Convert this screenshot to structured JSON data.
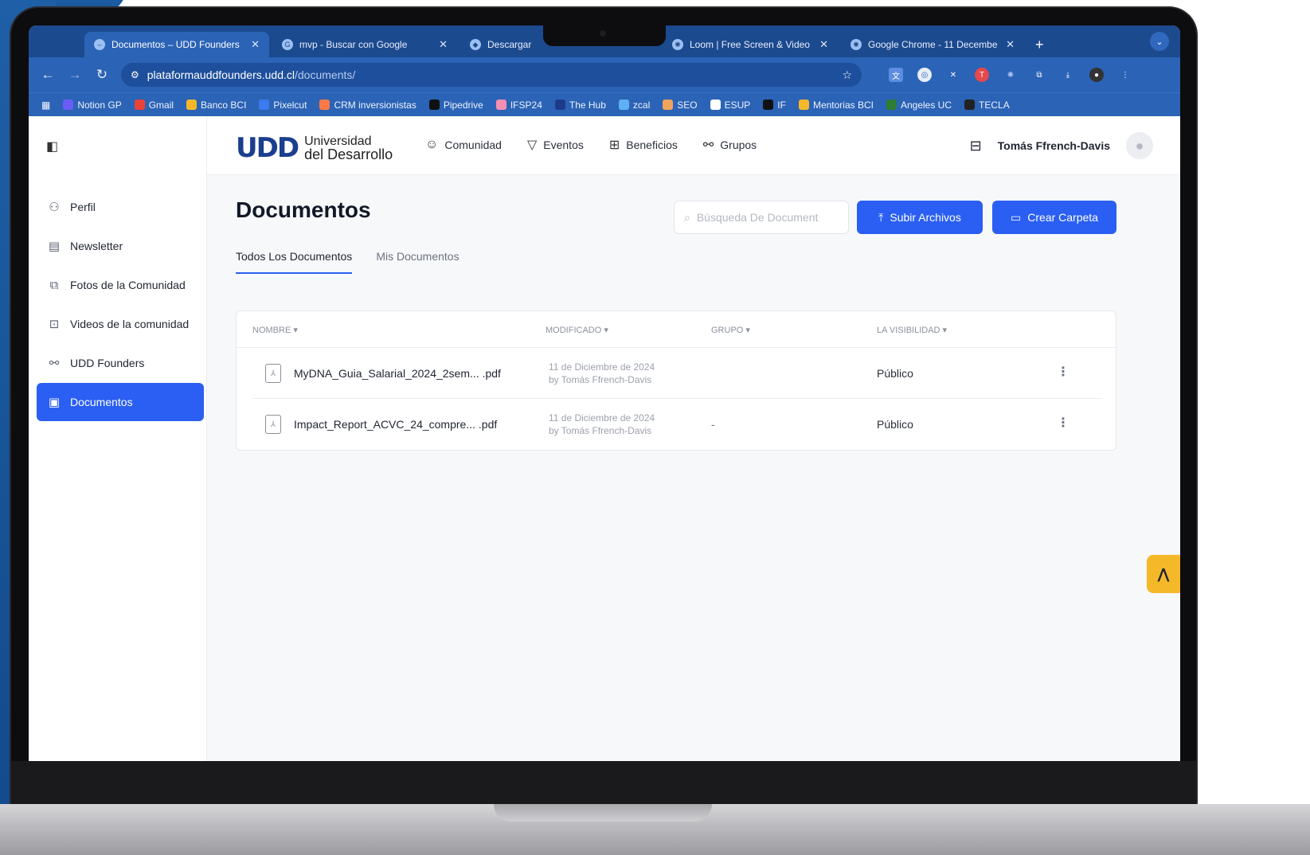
{
  "browser": {
    "tabs": [
      {
        "title": "Documentos – UDD Founders",
        "active": true
      },
      {
        "title": "mvp - Buscar con Google",
        "active": false
      },
      {
        "title": "Descargar",
        "active": false
      },
      {
        "title": "Loom | Free Screen & Video R",
        "active": false
      },
      {
        "title": "Google Chrome - 11 Decembe",
        "active": false
      }
    ],
    "url_host": "plataformauddfounders.udd.cl",
    "url_path": "/documents/",
    "bookmarks": [
      "Notion GP",
      "Gmail",
      "Banco BCI",
      "Pixelcut",
      "CRM inversionistas",
      "Pipedrive",
      "IFSP24",
      "The Hub",
      "zcal",
      "SEO",
      "ESUP",
      "IF",
      "Mentorias BCI",
      "Angeles UC",
      "TECLA"
    ]
  },
  "header": {
    "logo_mark": "UDD",
    "logo_line1": "Universidad",
    "logo_line2": "del Desarrollo",
    "nav": [
      "Comunidad",
      "Eventos",
      "Beneficios",
      "Grupos"
    ],
    "user_name": "Tomás Ffrench-Davis"
  },
  "sidebar": {
    "items": [
      {
        "label": "Perfil",
        "active": false
      },
      {
        "label": "Newsletter",
        "active": false
      },
      {
        "label": "Fotos de la Comunidad",
        "active": false
      },
      {
        "label": "Videos de la comunidad",
        "active": false
      },
      {
        "label": "UDD Founders",
        "active": false
      },
      {
        "label": "Documentos",
        "active": true
      }
    ]
  },
  "main": {
    "title": "Documentos",
    "search_placeholder": "Búsqueda De Document",
    "upload_label": "Subir Archivos",
    "create_folder_label": "Crear Carpeta",
    "tabs": [
      {
        "label": "Todos Los Documentos",
        "active": true
      },
      {
        "label": "Mis Documentos",
        "active": false
      }
    ],
    "columns": [
      "NOMBRE ▾",
      "MODIFICADO ▾",
      "GRUPO ▾",
      "LA VISIBILIDAD ▾"
    ],
    "rows": [
      {
        "name": "MyDNA_Guia_Salarial_2024_2sem... .pdf",
        "modified_date": "11 de Diciembre de 2024",
        "modified_by": "by Tomás Ffrench-Davis",
        "group": "",
        "visibility": "Público"
      },
      {
        "name": "Impact_Report_ACVC_24_compre... .pdf",
        "modified_date": "11 de Diciembre de 2024",
        "modified_by": "by Tomás Ffrench-Davis",
        "group": "-",
        "visibility": "Público"
      }
    ]
  },
  "colors": {
    "primary": "#2b5ff3",
    "browser_frame": "#2b63b6",
    "help_tab": "#f5b829"
  }
}
